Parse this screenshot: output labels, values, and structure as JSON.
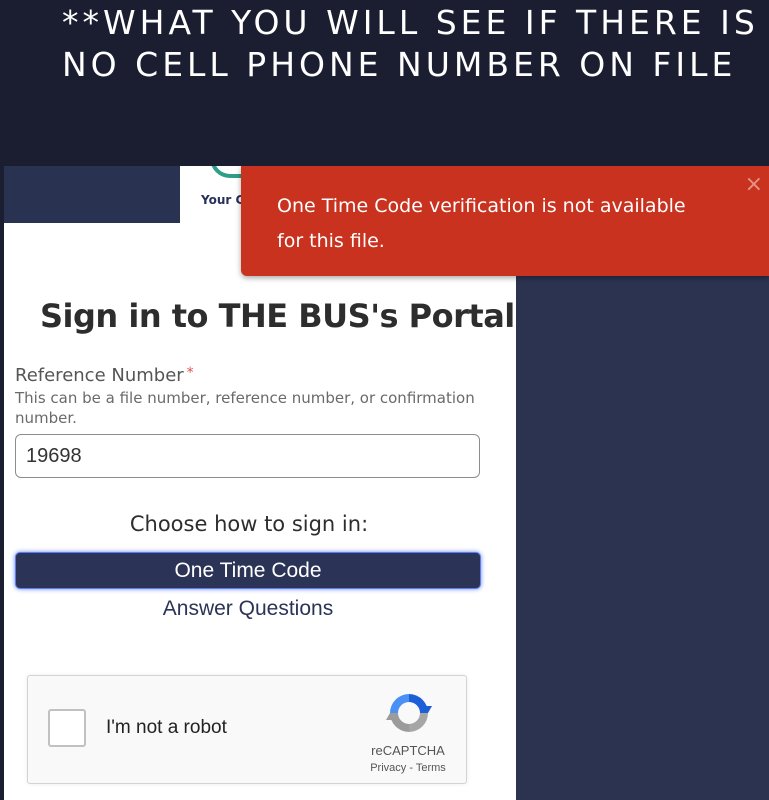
{
  "slide": {
    "title": "**WHAT YOU WILL SEE IF THERE IS NO CELL PHONE NUMBER ON FILE"
  },
  "header": {
    "logo_text": "Your C"
  },
  "toast": {
    "message": "One Time Code verification is not available for this file.",
    "close_symbol": "×",
    "color": "#c8321f"
  },
  "signin": {
    "title": "Sign in to THE BUS's Portal",
    "reference_label": "Reference Number",
    "required_mark": "*",
    "reference_help": "This can be a file number, reference number, or confirmation number.",
    "reference_value": "19698",
    "choose_label": "Choose how to sign in:",
    "one_time_code_label": "One Time Code",
    "answer_questions_label": "Answer Questions"
  },
  "captcha": {
    "checkbox_label": "I'm not a robot",
    "brand": "reCAPTCHA",
    "privacy": "Privacy",
    "separator": " - ",
    "terms": "Terms",
    "icon": "recaptcha-icon"
  },
  "colors": {
    "background": "#1b1e30",
    "panel_dark": "#2b3350",
    "button_primary": "#2b3456"
  }
}
